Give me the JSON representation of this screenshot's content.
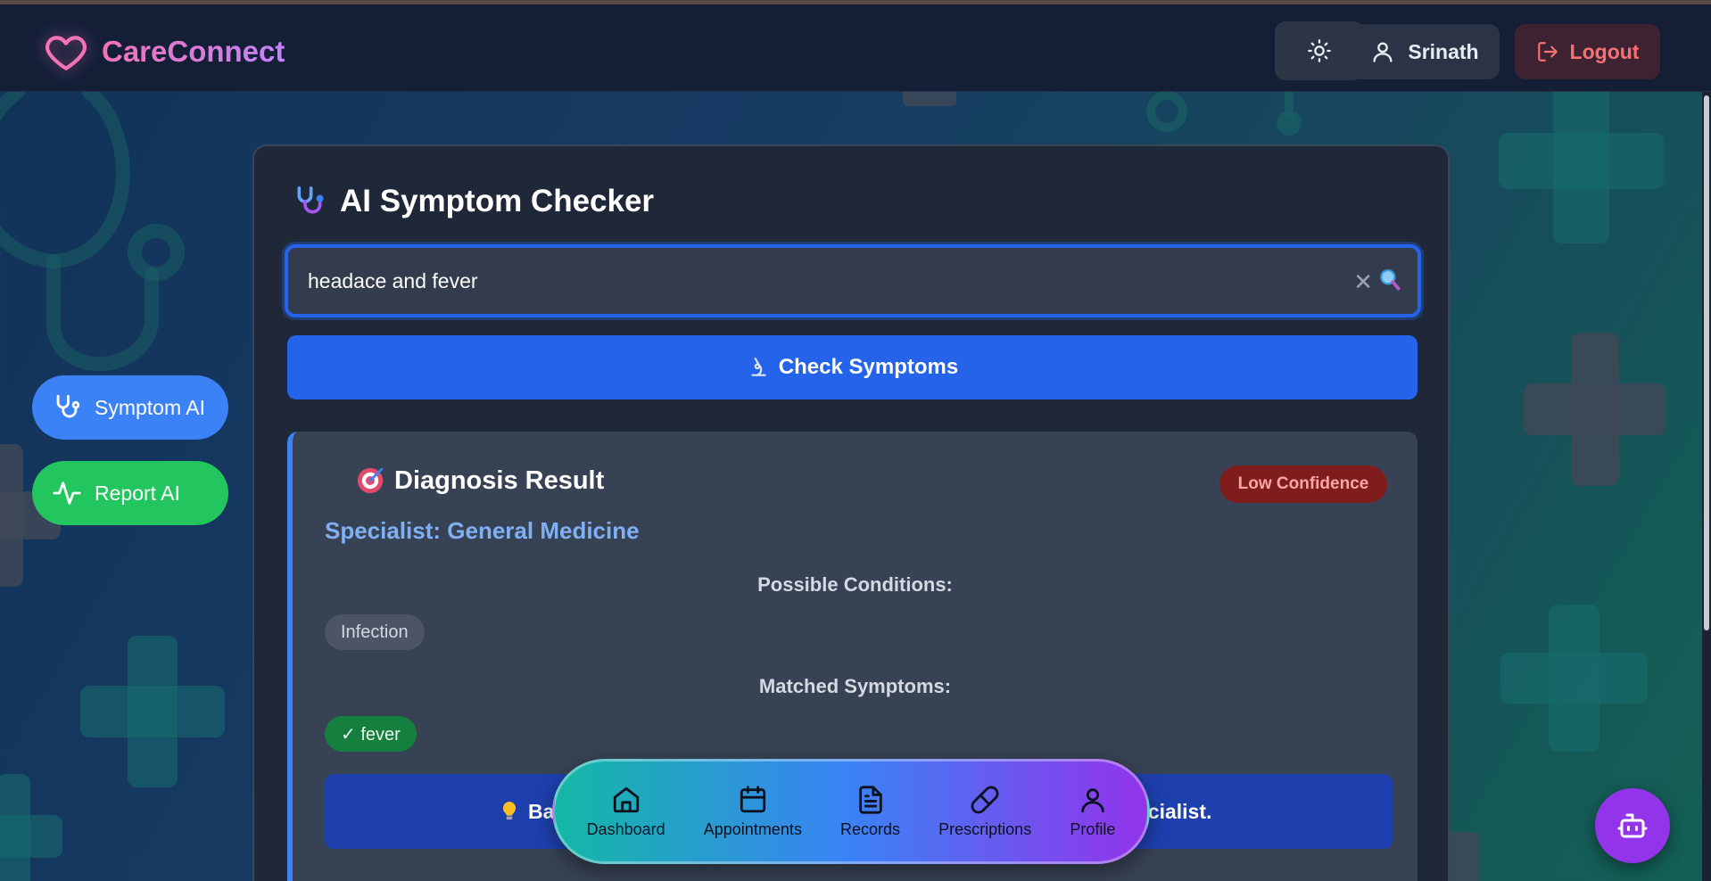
{
  "header": {
    "brand": "CareConnect",
    "user_name": "Srinath",
    "logout_label": "Logout"
  },
  "side_nav": {
    "symptom_label": "Symptom AI",
    "report_label": "Report AI"
  },
  "checker": {
    "title": "AI Symptom Checker",
    "input_value": "headace and fever",
    "check_label": "Check Symptoms"
  },
  "result": {
    "title": "Diagnosis Result",
    "confidence": "Low Confidence",
    "specialist": "Specialist: General Medicine",
    "conditions_heading": "Possible Conditions:",
    "conditions": [
      "Infection"
    ],
    "matched_heading": "Matched Symptoms:",
    "matched": [
      "✓ fever"
    ],
    "advice_start": "Ba",
    "advice_end": "ecialist."
  },
  "bottom_nav": {
    "items": [
      {
        "label": "Dashboard",
        "icon": "home-icon"
      },
      {
        "label": "Appointments",
        "icon": "calendar-icon"
      },
      {
        "label": "Records",
        "icon": "document-icon"
      },
      {
        "label": "Prescriptions",
        "icon": "pill-icon"
      },
      {
        "label": "Profile",
        "icon": "user-icon"
      }
    ]
  },
  "colors": {
    "primary": "#2563eb",
    "success": "#22c55e",
    "danger": "#f87171",
    "accent": "#9333ea"
  }
}
